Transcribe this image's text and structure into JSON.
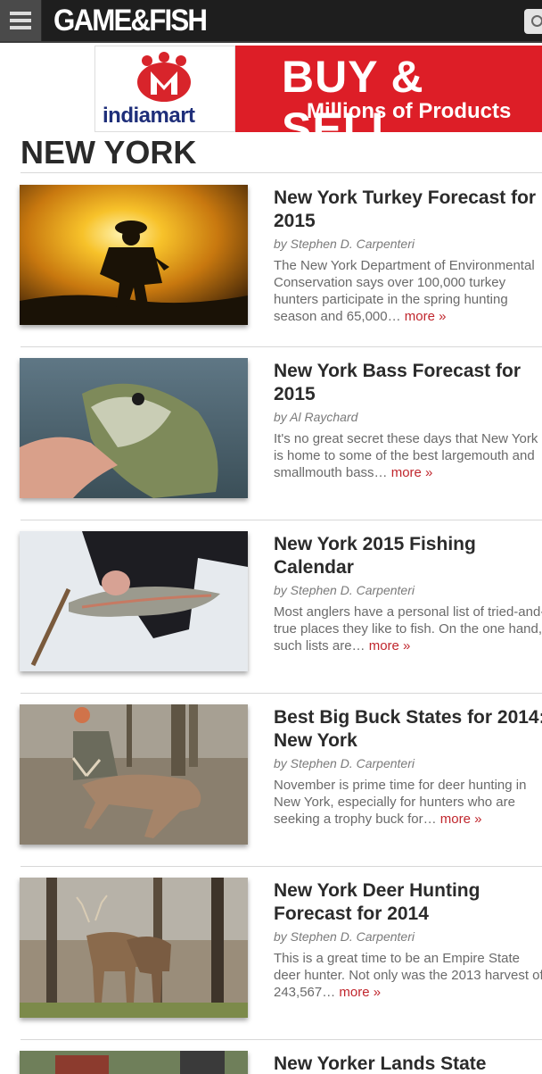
{
  "header": {
    "logo": "GAME&FISH"
  },
  "ad": {
    "brand": "indiamart",
    "headline": "BUY & SELL",
    "subline": "Millions of Products"
  },
  "page": {
    "title": "NEW YORK"
  },
  "articles": [
    {
      "title": "New York Turkey Forecast for 2015",
      "author": "by Stephen D. Carpenteri",
      "excerpt": "The New York Department of Environmental Conservation says over 100,000 turkey hunters participate in the spring hunting season and 65,000…",
      "more": "more »"
    },
    {
      "title": "New York Bass Forecast for 2015",
      "author": "by Al Raychard",
      "excerpt": "It's no great secret these days that New York is home to some of the best largemouth and smallmouth bass…",
      "more": "more »"
    },
    {
      "title": "New York 2015 Fishing Calendar",
      "author": "by Stephen D. Carpenteri",
      "excerpt": "Most anglers have a personal list of tried-and-true places they like to fish. On the one hand, such lists are…",
      "more": "more »"
    },
    {
      "title": "Best Big Buck States for 2014: New York",
      "author": "by Stephen D. Carpenteri",
      "excerpt": "November is prime time for deer hunting in New York, especially for hunters who are seeking a trophy buck for…",
      "more": "more »"
    },
    {
      "title": "New York Deer Hunting Forecast for 2014",
      "author": "by Stephen D. Carpenteri",
      "excerpt": "This is a great time to be an Empire State deer hunter. Not only was the 2013 harvest of 243,567…",
      "more": "more »"
    },
    {
      "title": "New Yorker Lands State"
    }
  ]
}
